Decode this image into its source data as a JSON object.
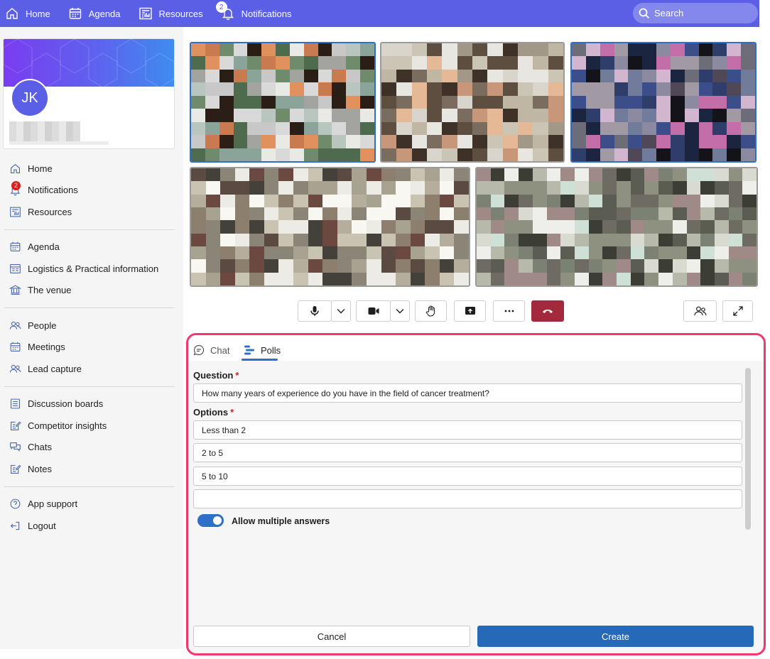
{
  "topnav": {
    "items": [
      {
        "label": "Home",
        "icon": "home-icon"
      },
      {
        "label": "Agenda",
        "icon": "calendar-icon"
      },
      {
        "label": "Resources",
        "icon": "resources-icon"
      },
      {
        "label": "Notifications",
        "icon": "bell-icon",
        "badge": "2"
      }
    ],
    "search_label": "Search",
    "color": "#5b5fe6"
  },
  "profile": {
    "initials": "JK"
  },
  "sidebar": {
    "groups": [
      [
        {
          "label": "Home",
          "icon": "home-icon"
        },
        {
          "label": "Notifications",
          "icon": "bell-icon",
          "badge": "2"
        },
        {
          "label": "Resources",
          "icon": "resources-icon"
        }
      ],
      [
        {
          "label": "Agenda",
          "icon": "calendar-icon"
        },
        {
          "label": "Logistics & Practical information",
          "icon": "info-board-icon"
        },
        {
          "label": "The venue",
          "icon": "building-icon"
        }
      ],
      [
        {
          "label": "People",
          "icon": "people-icon"
        },
        {
          "label": "Meetings",
          "icon": "calendar-icon"
        },
        {
          "label": "Lead capture",
          "icon": "people-icon"
        }
      ],
      [
        {
          "label": "Discussion boards",
          "icon": "board-icon"
        },
        {
          "label": "Competitor insights",
          "icon": "edit-note-icon"
        },
        {
          "label": "Chats",
          "icon": "chat-icon"
        },
        {
          "label": "Notes",
          "icon": "edit-note-icon"
        }
      ],
      [
        {
          "label": "App support",
          "icon": "help-icon"
        },
        {
          "label": "Logout",
          "icon": "logout-icon"
        }
      ]
    ]
  },
  "call_controls": {
    "buttons": [
      "mic-icon",
      "mic-options-chevron-icon",
      "camera-icon",
      "camera-options-chevron-icon",
      "raise-hand-icon",
      "share-screen-icon",
      "more-icon",
      "hang-up-icon"
    ],
    "right_buttons": [
      "participants-icon",
      "expand-icon"
    ],
    "hangup_color": "#a3293d"
  },
  "panel": {
    "tabs": [
      {
        "label": "Chat",
        "icon": "chat-icon"
      },
      {
        "label": "Polls",
        "icon": "polls-icon",
        "active": true
      }
    ],
    "question_label": "Question",
    "question_value": "How many years of experience do you have in the field of cancer treatment?",
    "options_label": "Options",
    "required_mark": "*",
    "options": [
      "Less than 2",
      "2 to 5",
      "5 to 10",
      ""
    ],
    "allow_multiple_label": "Allow multiple answers",
    "allow_multiple": true,
    "cancel_label": "Cancel",
    "create_label": "Create",
    "accent_color": "#2f6fc9",
    "highlight_color": "#f1376e"
  }
}
